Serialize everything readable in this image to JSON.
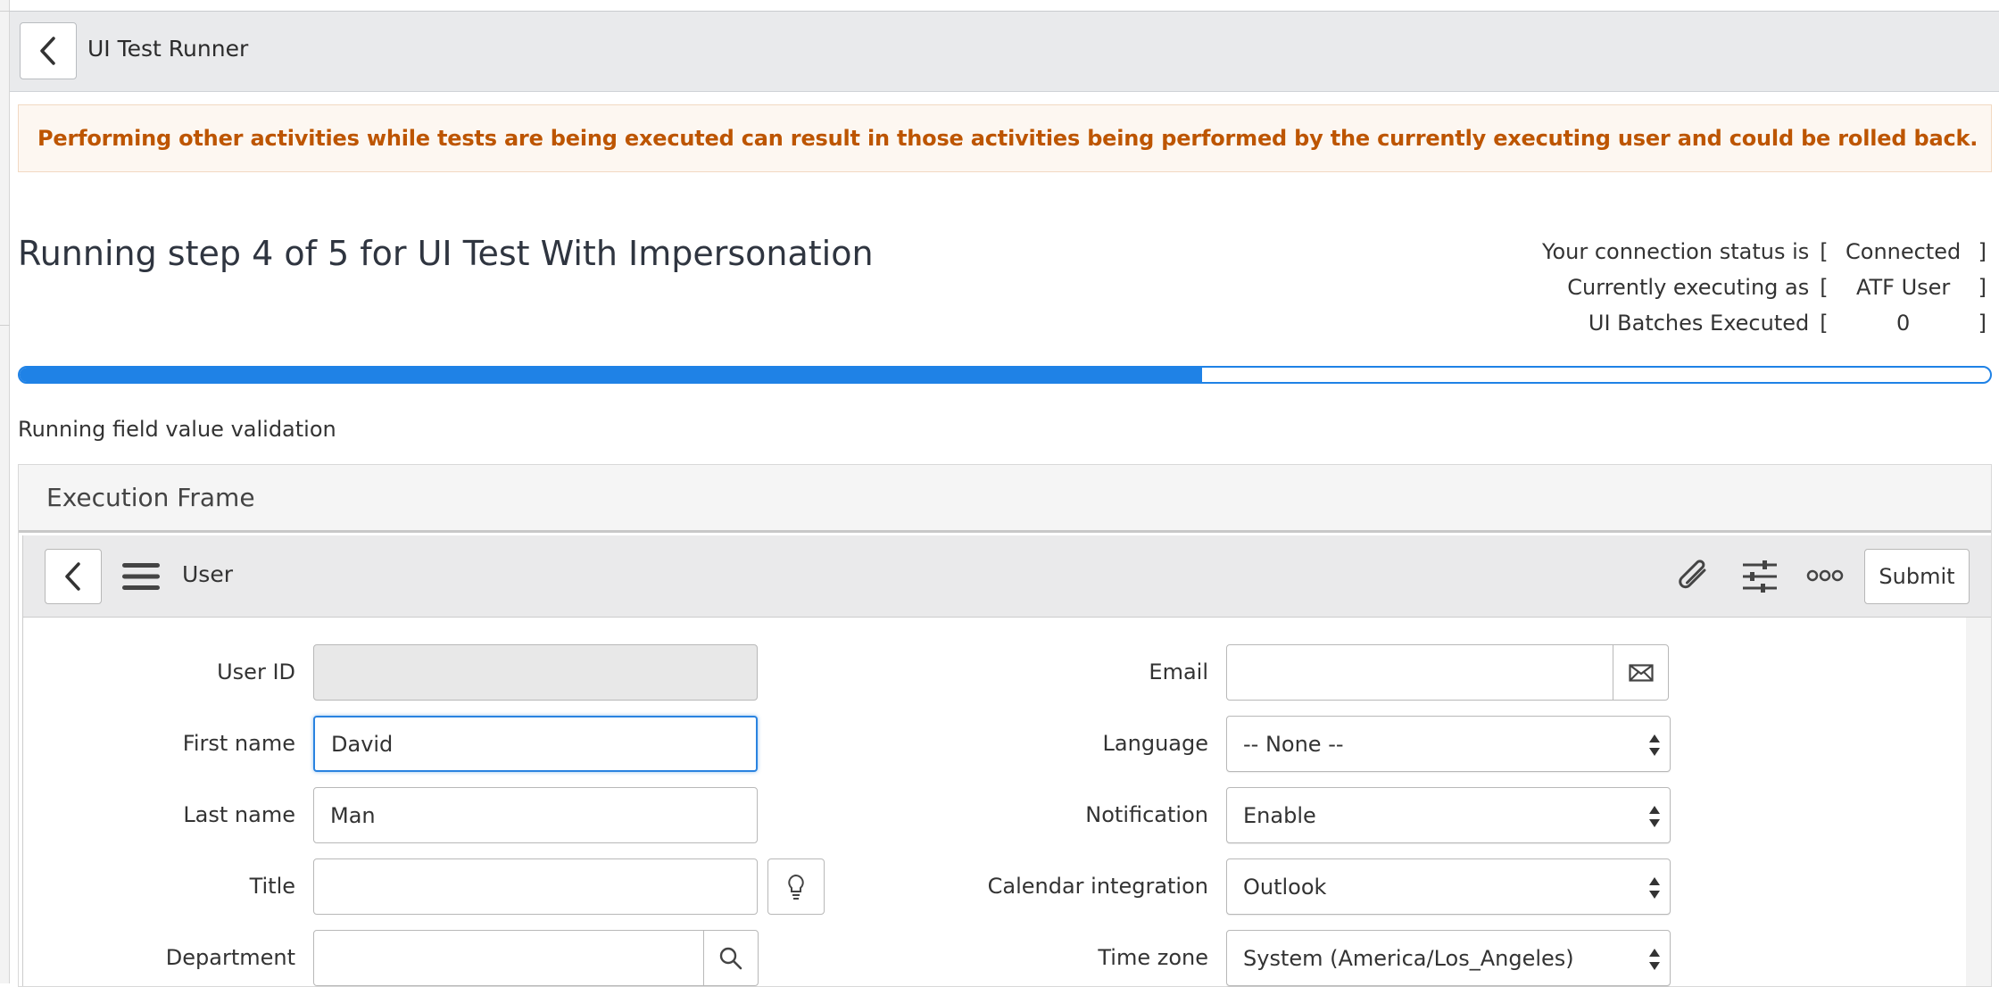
{
  "header": {
    "title": "UI Test Runner"
  },
  "warning": {
    "text": "Performing other activities while tests are being executed can result in those activities being performed by the currently executing user and could be rolled back."
  },
  "page": {
    "title": "Running step 4 of 5 for UI Test With Impersonation"
  },
  "status": {
    "connection_label": "Your connection status is",
    "connection_value": "Connected",
    "executing_label": "Currently executing as",
    "executing_value": "ATF User",
    "batches_label": "UI Batches Executed",
    "batches_value": "0",
    "bracket_open": "[",
    "bracket_close": "]"
  },
  "progress": {
    "fraction": 0.6,
    "color": "#1f82e6"
  },
  "step_text": "Running field value validation",
  "exec_frame": {
    "title": "Execution Frame"
  },
  "form": {
    "title": "User",
    "submit_label": "Submit",
    "fields_left": [
      {
        "label": "User ID",
        "value": ""
      },
      {
        "label": "First name",
        "value": "David"
      },
      {
        "label": "Last name",
        "value": "Man"
      },
      {
        "label": "Title",
        "value": ""
      },
      {
        "label": "Department",
        "value": ""
      }
    ],
    "fields_right": [
      {
        "label": "Email",
        "value": ""
      },
      {
        "label": "Language",
        "value": "-- None --"
      },
      {
        "label": "Notification",
        "value": "Enable"
      },
      {
        "label": "Calendar integration",
        "value": "Outlook"
      },
      {
        "label": "Time zone",
        "value": "System (America/Los_Angeles)"
      }
    ]
  },
  "colors": {
    "warning_text": "#bd5500",
    "accent": "#1f82e6",
    "header_bg": "#e9eaec"
  }
}
